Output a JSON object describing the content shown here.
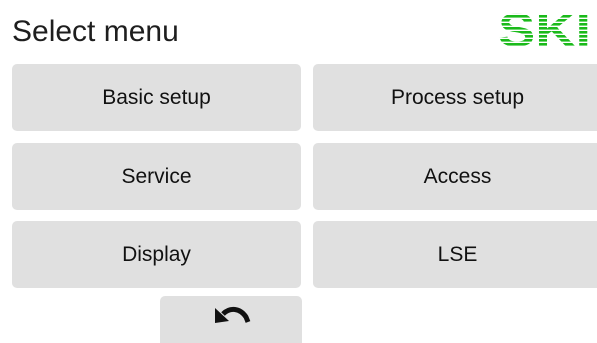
{
  "header": {
    "title": "Select menu",
    "logo_text": "SKI",
    "logo_color": "#1aba1a"
  },
  "menu": {
    "items": [
      {
        "label": "Basic setup"
      },
      {
        "label": "Process setup"
      },
      {
        "label": "Service"
      },
      {
        "label": "Access"
      },
      {
        "label": "Display"
      },
      {
        "label": "LSE"
      }
    ]
  },
  "back_button": {
    "icon": "undo-arrow-icon"
  },
  "colors": {
    "button_bg": "#e0e0e0",
    "text": "#1e1e1e",
    "brand": "#1aba1a"
  }
}
